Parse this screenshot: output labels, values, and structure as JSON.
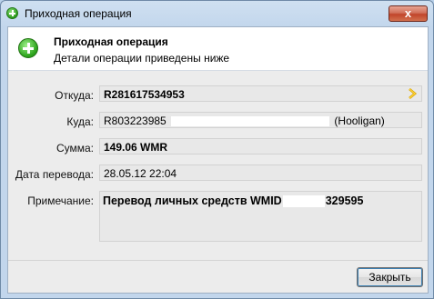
{
  "window": {
    "title": "Приходная операция",
    "close_glyph": "x"
  },
  "header": {
    "title": "Приходная операция",
    "subtitle": "Детали операции приведены ниже",
    "icon": "plus-circle-icon"
  },
  "fields": {
    "from_label": "Откуда:",
    "from_value": "R281617534953",
    "to_label": "Куда:",
    "to_value_prefix": "R803223985",
    "to_value_suffix": "(Hooligan)",
    "amount_label": "Сумма:",
    "amount_value": "149.06 WMR",
    "date_label": "Дата перевода:",
    "date_value": "28.05.12 22:04",
    "note_label": "Примечание:",
    "note_value_prefix": "Перевод личных средств WMID",
    "note_value_suffix": "329595"
  },
  "buttons": {
    "close_label": "Закрыть"
  }
}
